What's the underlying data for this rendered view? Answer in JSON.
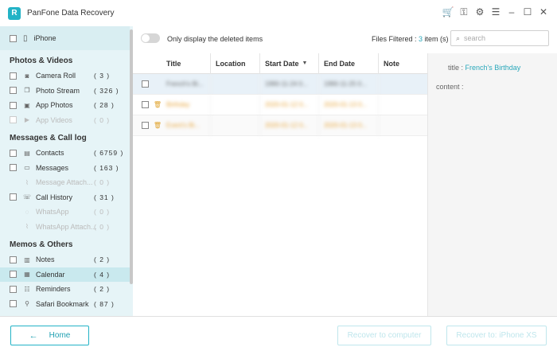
{
  "app": {
    "title": "PanFone Data Recovery",
    "logo_letter": "R"
  },
  "titlebar": {
    "icons": [
      "cart-icon",
      "key-icon",
      "gear-icon",
      "menu-icon",
      "minimize-icon",
      "maximize-icon",
      "close-icon"
    ]
  },
  "sidebar": {
    "device": "iPhone",
    "sections": [
      {
        "title": "Photos & Videos",
        "items": [
          {
            "label": "Camera Roll",
            "count": "( 3 )",
            "icon": "camera-icon",
            "enabled": true
          },
          {
            "label": "Photo Stream",
            "count": "( 326 )",
            "icon": "photo-stream-icon",
            "enabled": true
          },
          {
            "label": "App Photos",
            "count": "( 28 )",
            "icon": "image-icon",
            "enabled": true
          },
          {
            "label": "App Videos",
            "count": "( 0 )",
            "icon": "video-icon",
            "enabled": false
          }
        ]
      },
      {
        "title": "Messages & Call log",
        "items": [
          {
            "label": "Contacts",
            "count": "( 6759 )",
            "icon": "contacts-icon",
            "enabled": true
          },
          {
            "label": "Messages",
            "count": "( 163 )",
            "icon": "message-icon",
            "enabled": true
          },
          {
            "label": "Message Attach...",
            "count": "( 0 )",
            "icon": "paperclip-icon",
            "enabled": false
          },
          {
            "label": "Call History",
            "count": "( 31 )",
            "icon": "phone-icon",
            "enabled": true
          },
          {
            "label": "WhatsApp",
            "count": "( 0 )",
            "icon": "whatsapp-icon",
            "enabled": false
          },
          {
            "label": "WhatsApp Attach...",
            "count": "( 0 )",
            "icon": "paperclip-icon",
            "enabled": false
          }
        ]
      },
      {
        "title": "Memos & Others",
        "items": [
          {
            "label": "Notes",
            "count": "( 2 )",
            "icon": "notes-icon",
            "enabled": true
          },
          {
            "label": "Calendar",
            "count": "( 4 )",
            "icon": "calendar-icon",
            "enabled": true,
            "active": true
          },
          {
            "label": "Reminders",
            "count": "( 2 )",
            "icon": "reminder-icon",
            "enabled": true
          },
          {
            "label": "Safari Bookmark",
            "count": "( 87 )",
            "icon": "bookmark-icon",
            "enabled": true
          }
        ]
      }
    ]
  },
  "toolbar": {
    "toggle_label": "Only display the deleted items",
    "filtered_prefix": "Files Filtered : ",
    "filtered_count": "3",
    "filtered_suffix": " item (s)",
    "search_placeholder": "search"
  },
  "table": {
    "columns": [
      "Title",
      "Location",
      "Start Date",
      "End Date",
      "Note"
    ],
    "sort_indicator": "▼",
    "rows": [
      {
        "title": "French's Bi...",
        "location": "",
        "start": "1990-11-24 0...",
        "end": "1990-11-25 0...",
        "note": "",
        "deleted": false
      },
      {
        "title": "Birthday",
        "location": "",
        "start": "2020-01-12 0...",
        "end": "2020-01-13 0...",
        "note": "",
        "deleted": true
      },
      {
        "title": "Event's Bi...",
        "location": "",
        "start": "2020-01-12 0...",
        "end": "2020-01-13 0...",
        "note": "",
        "deleted": true
      }
    ]
  },
  "detail": {
    "title_label": "title : ",
    "title_value": "French's Birthday",
    "content_label": "content :"
  },
  "footer": {
    "home": "Home",
    "recover_computer": "Recover to computer",
    "recover_device": "Recover to: iPhone XS"
  },
  "colors": {
    "accent": "#23b3c6",
    "deleted": "#e8a53a",
    "sidebar_bg": "#e6f4f7"
  }
}
